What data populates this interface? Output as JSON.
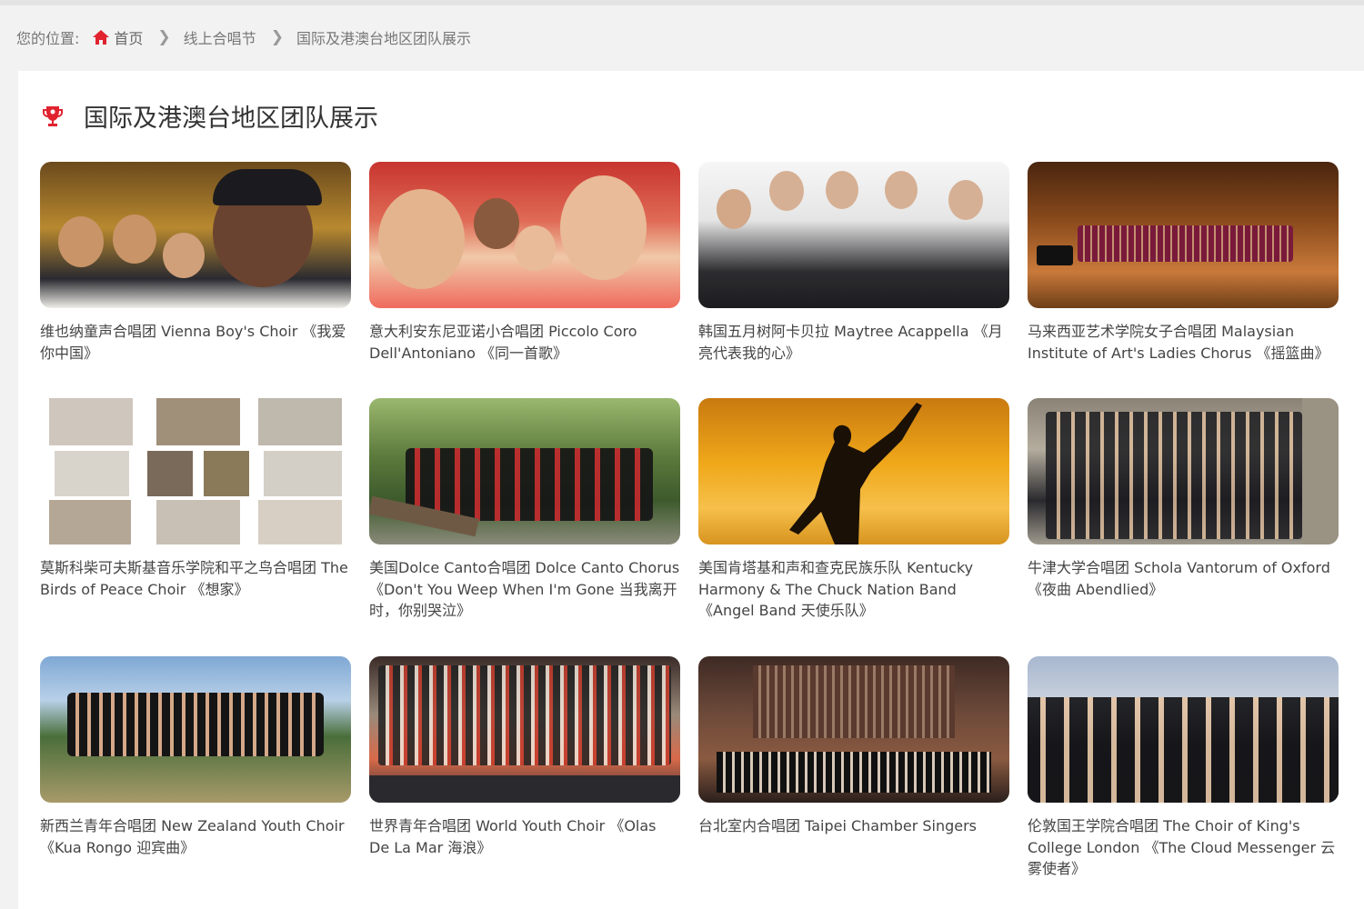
{
  "breadcrumb": {
    "prefix": "您的位置:",
    "home": "首页",
    "level1": "线上合唱节",
    "current": "国际及港澳台地区团队展示"
  },
  "section": {
    "title": "国际及港澳台地区团队展示"
  },
  "cards": [
    {
      "caption": "维也纳童声合唱团 Vienna Boy's Choir 《我爱你中国》"
    },
    {
      "caption": "意大利安东尼亚诺小合唱团 Piccolo Coro Dell'Antoniano 《同一首歌》"
    },
    {
      "caption": "韩国五月树阿卡贝拉 Maytree Acappella 《月亮代表我的心》"
    },
    {
      "caption": "马来西亚艺术学院女子合唱团 Malaysian Institute of Art's Ladies Chorus 《摇篮曲》"
    },
    {
      "caption": "莫斯科柴可夫斯基音乐学院和平之鸟合唱团 The Birds of Peace Choir 《想家》"
    },
    {
      "caption": "美国Dolce Canto合唱团 Dolce Canto Chorus 《Don't You Weep When I'm Gone 当我离开时，你别哭泣》"
    },
    {
      "caption": "美国肯塔基和声和查克民族乐队 Kentucky Harmony & The Chuck Nation Band 《Angel Band 天使乐队》"
    },
    {
      "caption": "牛津大学合唱团 Schola Vantorum of Oxford 《夜曲 Abendlied》"
    },
    {
      "caption": "新西兰青年合唱团 New Zealand Youth Choir 《Kua Rongo 迎宾曲》"
    },
    {
      "caption": "世界青年合唱团 World Youth Choir 《Olas De La Mar 海浪》"
    },
    {
      "caption": "台北室内合唱团 Taipei Chamber Singers"
    },
    {
      "caption": "伦敦国王学院合唱团 The Choir of King's College London 《The Cloud Messenger 云雾使者》"
    }
  ],
  "colors": {
    "accent": "#e0232f",
    "panel": "#ffffff",
    "background": "#f2f2f2"
  }
}
